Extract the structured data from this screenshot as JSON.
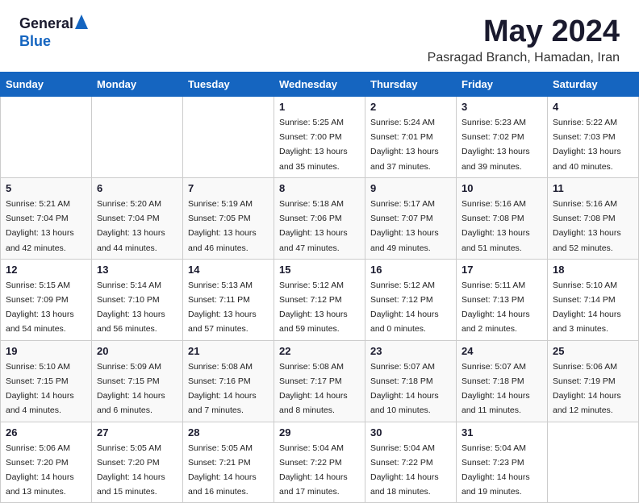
{
  "header": {
    "logo_general": "General",
    "logo_blue": "Blue",
    "title": "May 2024",
    "location": "Pasragad Branch, Hamadan, Iran"
  },
  "days_of_week": [
    "Sunday",
    "Monday",
    "Tuesday",
    "Wednesday",
    "Thursday",
    "Friday",
    "Saturday"
  ],
  "weeks": [
    [
      null,
      null,
      null,
      {
        "day": "1",
        "sunrise": "Sunrise: 5:25 AM",
        "sunset": "Sunset: 7:00 PM",
        "daylight": "Daylight: 13 hours and 35 minutes."
      },
      {
        "day": "2",
        "sunrise": "Sunrise: 5:24 AM",
        "sunset": "Sunset: 7:01 PM",
        "daylight": "Daylight: 13 hours and 37 minutes."
      },
      {
        "day": "3",
        "sunrise": "Sunrise: 5:23 AM",
        "sunset": "Sunset: 7:02 PM",
        "daylight": "Daylight: 13 hours and 39 minutes."
      },
      {
        "day": "4",
        "sunrise": "Sunrise: 5:22 AM",
        "sunset": "Sunset: 7:03 PM",
        "daylight": "Daylight: 13 hours and 40 minutes."
      }
    ],
    [
      {
        "day": "5",
        "sunrise": "Sunrise: 5:21 AM",
        "sunset": "Sunset: 7:04 PM",
        "daylight": "Daylight: 13 hours and 42 minutes."
      },
      {
        "day": "6",
        "sunrise": "Sunrise: 5:20 AM",
        "sunset": "Sunset: 7:04 PM",
        "daylight": "Daylight: 13 hours and 44 minutes."
      },
      {
        "day": "7",
        "sunrise": "Sunrise: 5:19 AM",
        "sunset": "Sunset: 7:05 PM",
        "daylight": "Daylight: 13 hours and 46 minutes."
      },
      {
        "day": "8",
        "sunrise": "Sunrise: 5:18 AM",
        "sunset": "Sunset: 7:06 PM",
        "daylight": "Daylight: 13 hours and 47 minutes."
      },
      {
        "day": "9",
        "sunrise": "Sunrise: 5:17 AM",
        "sunset": "Sunset: 7:07 PM",
        "daylight": "Daylight: 13 hours and 49 minutes."
      },
      {
        "day": "10",
        "sunrise": "Sunrise: 5:16 AM",
        "sunset": "Sunset: 7:08 PM",
        "daylight": "Daylight: 13 hours and 51 minutes."
      },
      {
        "day": "11",
        "sunrise": "Sunrise: 5:16 AM",
        "sunset": "Sunset: 7:08 PM",
        "daylight": "Daylight: 13 hours and 52 minutes."
      }
    ],
    [
      {
        "day": "12",
        "sunrise": "Sunrise: 5:15 AM",
        "sunset": "Sunset: 7:09 PM",
        "daylight": "Daylight: 13 hours and 54 minutes."
      },
      {
        "day": "13",
        "sunrise": "Sunrise: 5:14 AM",
        "sunset": "Sunset: 7:10 PM",
        "daylight": "Daylight: 13 hours and 56 minutes."
      },
      {
        "day": "14",
        "sunrise": "Sunrise: 5:13 AM",
        "sunset": "Sunset: 7:11 PM",
        "daylight": "Daylight: 13 hours and 57 minutes."
      },
      {
        "day": "15",
        "sunrise": "Sunrise: 5:12 AM",
        "sunset": "Sunset: 7:12 PM",
        "daylight": "Daylight: 13 hours and 59 minutes."
      },
      {
        "day": "16",
        "sunrise": "Sunrise: 5:12 AM",
        "sunset": "Sunset: 7:12 PM",
        "daylight": "Daylight: 14 hours and 0 minutes."
      },
      {
        "day": "17",
        "sunrise": "Sunrise: 5:11 AM",
        "sunset": "Sunset: 7:13 PM",
        "daylight": "Daylight: 14 hours and 2 minutes."
      },
      {
        "day": "18",
        "sunrise": "Sunrise: 5:10 AM",
        "sunset": "Sunset: 7:14 PM",
        "daylight": "Daylight: 14 hours and 3 minutes."
      }
    ],
    [
      {
        "day": "19",
        "sunrise": "Sunrise: 5:10 AM",
        "sunset": "Sunset: 7:15 PM",
        "daylight": "Daylight: 14 hours and 4 minutes."
      },
      {
        "day": "20",
        "sunrise": "Sunrise: 5:09 AM",
        "sunset": "Sunset: 7:15 PM",
        "daylight": "Daylight: 14 hours and 6 minutes."
      },
      {
        "day": "21",
        "sunrise": "Sunrise: 5:08 AM",
        "sunset": "Sunset: 7:16 PM",
        "daylight": "Daylight: 14 hours and 7 minutes."
      },
      {
        "day": "22",
        "sunrise": "Sunrise: 5:08 AM",
        "sunset": "Sunset: 7:17 PM",
        "daylight": "Daylight: 14 hours and 8 minutes."
      },
      {
        "day": "23",
        "sunrise": "Sunrise: 5:07 AM",
        "sunset": "Sunset: 7:18 PM",
        "daylight": "Daylight: 14 hours and 10 minutes."
      },
      {
        "day": "24",
        "sunrise": "Sunrise: 5:07 AM",
        "sunset": "Sunset: 7:18 PM",
        "daylight": "Daylight: 14 hours and 11 minutes."
      },
      {
        "day": "25",
        "sunrise": "Sunrise: 5:06 AM",
        "sunset": "Sunset: 7:19 PM",
        "daylight": "Daylight: 14 hours and 12 minutes."
      }
    ],
    [
      {
        "day": "26",
        "sunrise": "Sunrise: 5:06 AM",
        "sunset": "Sunset: 7:20 PM",
        "daylight": "Daylight: 14 hours and 13 minutes."
      },
      {
        "day": "27",
        "sunrise": "Sunrise: 5:05 AM",
        "sunset": "Sunset: 7:20 PM",
        "daylight": "Daylight: 14 hours and 15 minutes."
      },
      {
        "day": "28",
        "sunrise": "Sunrise: 5:05 AM",
        "sunset": "Sunset: 7:21 PM",
        "daylight": "Daylight: 14 hours and 16 minutes."
      },
      {
        "day": "29",
        "sunrise": "Sunrise: 5:04 AM",
        "sunset": "Sunset: 7:22 PM",
        "daylight": "Daylight: 14 hours and 17 minutes."
      },
      {
        "day": "30",
        "sunrise": "Sunrise: 5:04 AM",
        "sunset": "Sunset: 7:22 PM",
        "daylight": "Daylight: 14 hours and 18 minutes."
      },
      {
        "day": "31",
        "sunrise": "Sunrise: 5:04 AM",
        "sunset": "Sunset: 7:23 PM",
        "daylight": "Daylight: 14 hours and 19 minutes."
      },
      null
    ]
  ]
}
